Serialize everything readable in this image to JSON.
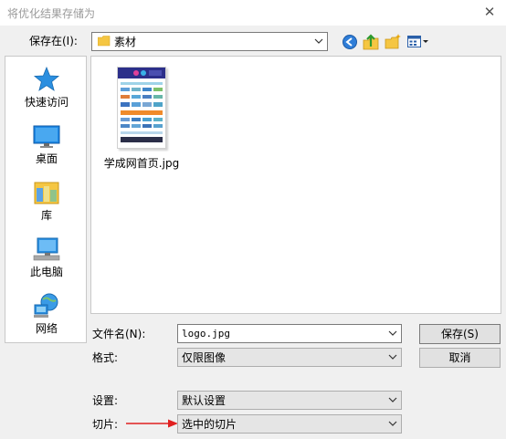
{
  "window": {
    "title": "将优化结果存储为",
    "close_label": "✕"
  },
  "save_in": {
    "label": "保存在(I):",
    "location": "素材"
  },
  "toolbar": {
    "icons": [
      "back-icon",
      "up-folder-icon",
      "new-folder-icon",
      "view-menu-icon"
    ]
  },
  "places": [
    {
      "label": "快速访问",
      "icon": "star-icon"
    },
    {
      "label": "桌面",
      "icon": "desktop-icon"
    },
    {
      "label": "库",
      "icon": "library-icon"
    },
    {
      "label": "此电脑",
      "icon": "computer-icon"
    },
    {
      "label": "网络",
      "icon": "network-icon"
    }
  ],
  "files": [
    {
      "name": "学成网首页.jpg"
    }
  ],
  "form": {
    "filename_label": "文件名(N):",
    "filename_value": "logo.jpg",
    "format_label": "格式:",
    "format_value": "仅限图像",
    "settings_label": "设置:",
    "settings_value": "默认设置",
    "slices_label": "切片:",
    "slices_value": "选中的切片"
  },
  "buttons": {
    "save": "保存(S)",
    "cancel": "取消"
  },
  "colors": {
    "annotation_arrow": "#e02020",
    "folder": "#f5c642"
  }
}
